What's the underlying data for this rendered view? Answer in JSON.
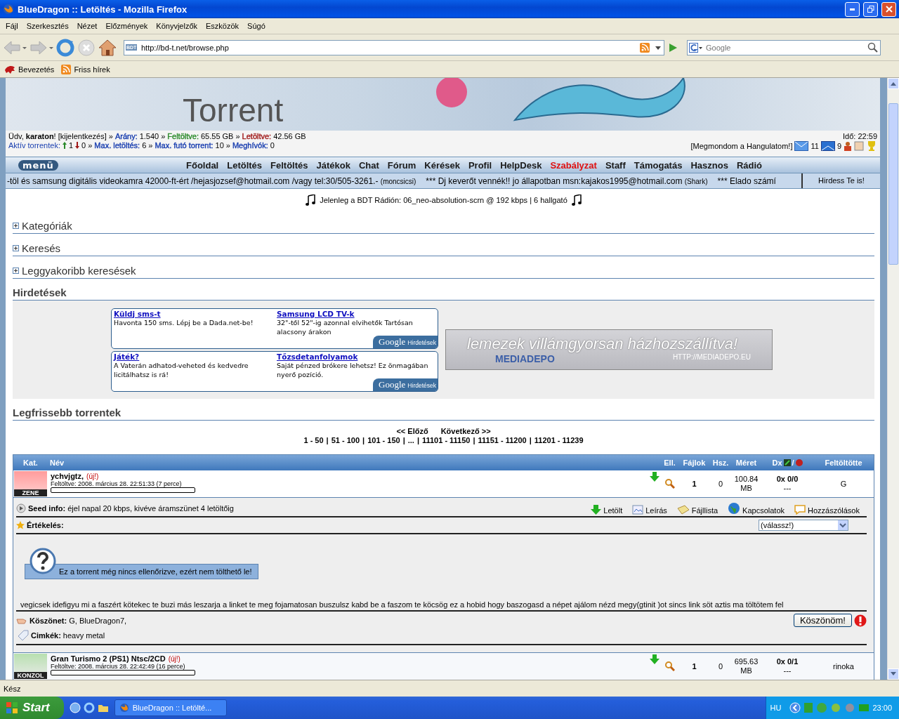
{
  "window": {
    "title": "BlueDragon :: Letöltés - Mozilla Firefox"
  },
  "menu_bar": [
    "Fájl",
    "Szerkesztés",
    "Nézet",
    "Előzmények",
    "Könyvjelzők",
    "Eszközök",
    "Súgó"
  ],
  "address_bar": {
    "url": "http://bd-t.net/browse.php",
    "favicon": "BDT"
  },
  "search": {
    "placeholder": "Google"
  },
  "bookmarks": [
    "Bevezetés",
    "Friss hírek"
  ],
  "page": {
    "banner": {
      "logo": "Torrent"
    },
    "user_bar": {
      "greeting": "Üdv, **karaton**!",
      "logout": "[kijelentkezés]",
      "stats_line_1": [
        {
          "sep": "»",
          "label": "Arány:",
          "value": "1.540",
          "color": "#1a3fb0"
        },
        {
          "sep": "»",
          "label": "Feltöltve:",
          "value": "65.55 GB",
          "color": "#2a8a2a"
        },
        {
          "sep": "»",
          "label": "Letöltve:",
          "value": "42.56 GB",
          "color": "#a01818"
        }
      ],
      "active_label": "Aktív torrentek:",
      "active_up": "1",
      "active_down": "0",
      "stats_line_2": [
        {
          "sep": "»",
          "label": "Max. letöltés:",
          "value": "6",
          "color": "#1a3fb0"
        },
        {
          "sep": "»",
          "label": "Max. futó torrent:",
          "value": "10",
          "color": "#1a3fb0"
        },
        {
          "sep": "»",
          "label": "Meghívók:",
          "value": "0",
          "color": "#1a3fb0"
        }
      ],
      "time": "Idő: 22:59",
      "mood": "[Megmondom a Hangulatom!]",
      "messages_new": "11",
      "messages_sent": "9"
    },
    "nav": {
      "logo": "menü",
      "items": [
        {
          "label": "Főoldal",
          "highlighted": false
        },
        {
          "label": "Letöltés",
          "highlighted": false
        },
        {
          "label": "Feltöltés",
          "highlighted": false
        },
        {
          "label": "Játékok",
          "highlighted": false
        },
        {
          "label": "Chat",
          "highlighted": false
        },
        {
          "label": "Fórum",
          "highlighted": false
        },
        {
          "label": "Kérések",
          "highlighted": false
        },
        {
          "label": "Profil",
          "highlighted": false
        },
        {
          "label": "HelpDesk",
          "highlighted": false
        },
        {
          "label": "Szabályzat",
          "highlighted": true
        },
        {
          "label": "Staff",
          "highlighted": false
        },
        {
          "label": "Támogatás",
          "highlighted": false
        },
        {
          "label": "Hasznos",
          "highlighted": false
        },
        {
          "label": "Rádió",
          "highlighted": false
        }
      ]
    },
    "ticker": {
      "items": [
        {
          "text": "-töl és samsung digitális videokamra 42000-ft-ért /hejasjozsef@hotmail.com /vagy tel:30/505-3261.-",
          "author": "(moncsicsi)"
        },
        {
          "text": "*** Dj keverőt vennék!! jo állapotban msn:kajakos1995@hotmail.com",
          "author": "(Shark)"
        },
        {
          "text": "*** Elado számí"
        }
      ],
      "ad": "Hirdess Te is!"
    },
    "radio": "Jelenleg a BDT Rádión: 06_neo-absolution-scrn @ 192 kbps | 6 hallgató",
    "sections": [
      {
        "title": "Kategóriák",
        "expanded": false
      },
      {
        "title": "Keresés",
        "expanded": false
      },
      {
        "title": "Leggyakoribb keresések",
        "expanded": false
      }
    ],
    "ads": {
      "title": "Hirdetések",
      "blocks": [
        {
          "items": [
            {
              "title": "Küldj sms-t",
              "text": "Havonta 150 sms. Lépj be a Dada.net-be!"
            },
            {
              "title": "Samsung LCD TV-k",
              "text": "32\"-től 52\"-ig azonnal elvihetők Tartósan alacsony árakon"
            }
          ],
          "badge_logo": "Google",
          "badge_text": "Hirdetések"
        },
        {
          "items": [
            {
              "title": "Játék?",
              "text": "A Vaterán adhatod-veheted és kedvedre licitálhatsz is rá!"
            },
            {
              "title": "Tőzsdetanfolyamok",
              "text": "Saját pénzed brókere lehetsz! Ez önmagában nyerő pozíció."
            }
          ],
          "badge_logo": "Google",
          "badge_text": "Hirdetések"
        }
      ],
      "banner": {
        "headline": "lemezek villámgyorsan házhozszállítva!",
        "brand": "MEDIADEPO",
        "url": "HTTP://MEDIADEPO.EU"
      }
    },
    "torrents": {
      "title": "Legfrissebb torrentek",
      "prev": "<< Előző",
      "next": "Következő >>",
      "separator": "|",
      "dx_separator": "/",
      "pages": [
        "1 - 50",
        "51 - 100",
        "101 - 150",
        "...",
        "11101 - 11150",
        "11151 - 11200",
        "11201 - 11239"
      ],
      "columns": [
        "Kat.",
        "Név",
        "Ell.",
        "Fájlok",
        "Hsz.",
        "Méret",
        "Dx",
        "Feltöltötte"
      ],
      "rows": [
        {
          "category": "ZENE",
          "name": "ychvjgtz,",
          "new_tag": "(új!)",
          "uploaded": "Feltöltve: 2008. március 28. 22:51:33 (7 perce)",
          "level": 0,
          "files": "1",
          "comments": "0",
          "size": "100.84",
          "size_unit": "MB",
          "dx": "0x 0/0",
          "dx_sub": "---",
          "uploader": "G",
          "expanded": true,
          "detail": {
            "seed_label": "Seed info:",
            "seed_text": "éjel napal 20 kbps, kivéve áramszünet 4 letöltőig",
            "actions": [
              {
                "kind": "download",
                "label": "Letölt"
              },
              {
                "kind": "description",
                "label": "Leírás"
              },
              {
                "kind": "filelist",
                "label": "Fájllista"
              },
              {
                "kind": "connections",
                "label": "Kapcsolatok"
              },
              {
                "kind": "comments",
                "label": "Hozzászólások"
              }
            ],
            "rating_label": "Értékelés:",
            "rating_select": "(válassz!)",
            "warning": "Ez a torrent még nincs ellenőrizve, ezért nem tölthető le!",
            "description": "vegicsek idefigyu mi a faszért kötekec te buzi más leszarja a linket te meg fojamatosan buszulsz kabd be a faszom te köcsög  ez a hobid hogy baszogasd a népet ajálom nézd megy(gtinit )ot sincs link söt aztis ma töltötem fel",
            "thanks_label": "Köszönet:",
            "thanks_text": "G, BlueDragon7,",
            "thanks_button": "Köszönöm!",
            "tags_label": "Cimkék:",
            "tags_text": "heavy metal"
          }
        },
        {
          "category": "KONZOL",
          "name": "Gran Turismo 2 (PS1) Ntsc/2CD",
          "new_tag": "(új!)",
          "uploaded": "Feltöltve: 2008. március 28. 22:42:49 (16 perce)",
          "level": 0,
          "files": "1",
          "comments": "0",
          "size": "695.63",
          "size_unit": "MB",
          "dx": "0x 0/1",
          "dx_sub": "---",
          "uploader": "rinoka",
          "expanded": false
        }
      ]
    }
  },
  "status_bar": "Kész",
  "taskbar": {
    "start": "Start",
    "task": "BlueDragon :: Letölté...",
    "language": "HU",
    "clock": "23:00"
  }
}
